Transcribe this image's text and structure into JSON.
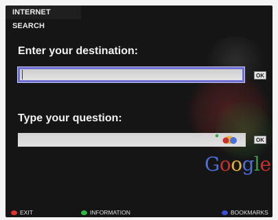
{
  "title": "INTERNET SEARCH",
  "destination": {
    "heading": "Enter your destination:",
    "value": "",
    "ok_label": "OK"
  },
  "question": {
    "heading": "Type your question:",
    "value": "",
    "ok_label": "OK"
  },
  "brand": {
    "letters": [
      "G",
      "o",
      "o",
      "g",
      "l",
      "e"
    ],
    "colors": [
      "#4a6fd6",
      "#c9302c",
      "#e8b33a",
      "#4a6fd6",
      "#3a9b3f",
      "#c9302c"
    ]
  },
  "footer": {
    "exit": {
      "label": "EXIT",
      "color": "#e03030"
    },
    "information": {
      "label": "INFORMATION",
      "color": "#2fb84a"
    },
    "bookmarks": {
      "label": "BOOKMARKS",
      "color": "#3a4fd6"
    }
  },
  "icons": {
    "balls": "colored-balls-icon",
    "ok": "ok-button"
  }
}
